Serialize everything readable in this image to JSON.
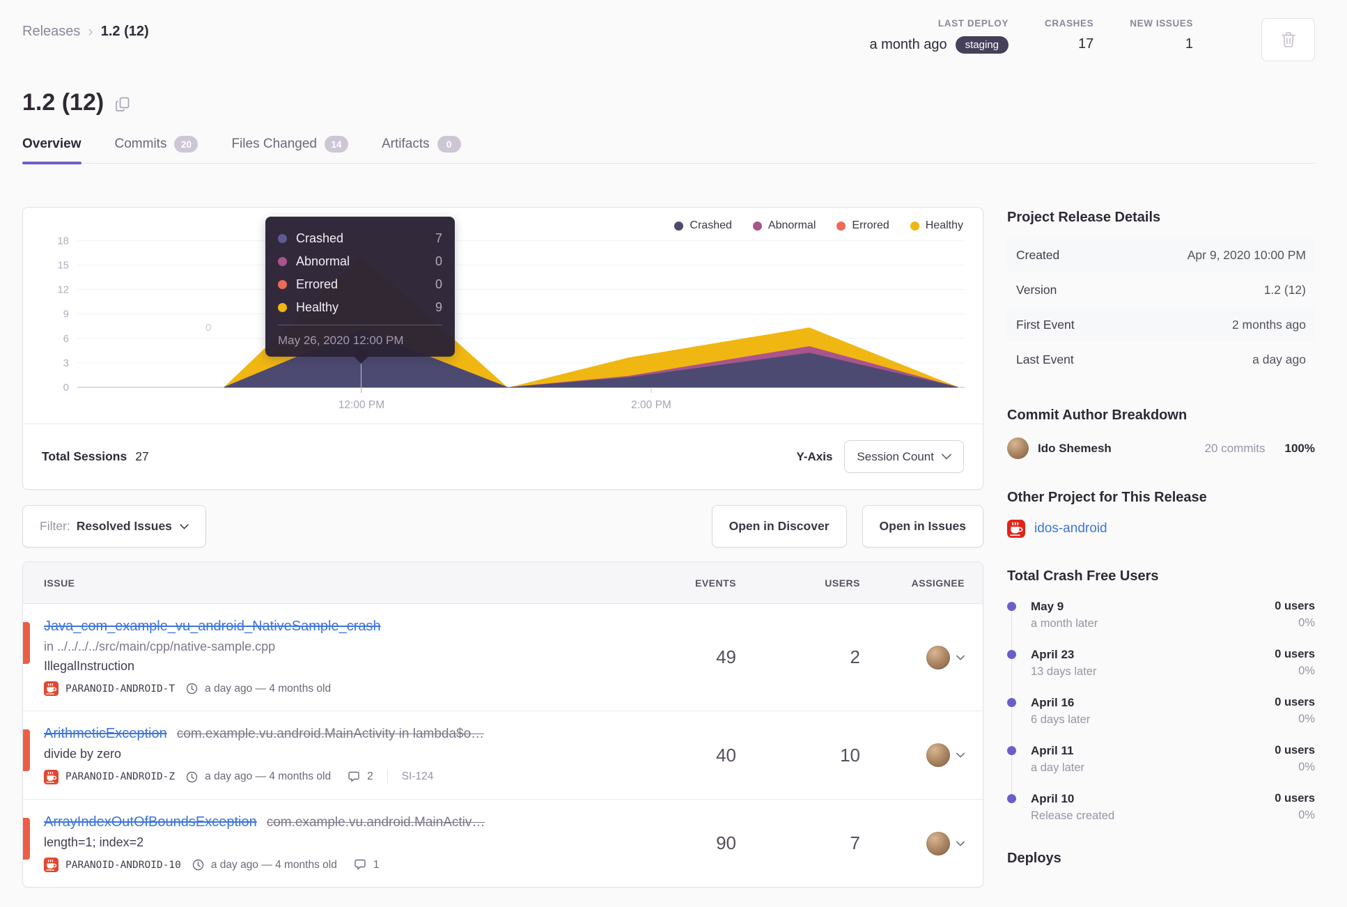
{
  "breadcrumb": {
    "parent": "Releases",
    "current": "1.2 (12)"
  },
  "header_stats": {
    "last_deploy": {
      "label": "LAST DEPLOY",
      "value": "a month ago",
      "env": "staging"
    },
    "crashes": {
      "label": "CRASHES",
      "value": "17"
    },
    "new_issues": {
      "label": "NEW ISSUES",
      "value": "1"
    }
  },
  "title": "1.2 (12)",
  "tabs": [
    {
      "label": "Overview",
      "active": true
    },
    {
      "label": "Commits",
      "badge": "20"
    },
    {
      "label": "Files Changed",
      "badge": "14"
    },
    {
      "label": "Artifacts",
      "badge": "0"
    }
  ],
  "colors": {
    "accent": "#6C5FC7",
    "link": "#3D74DB",
    "error_level": "#EC5E44",
    "env_badge": "#46405a"
  },
  "chart_data": {
    "type": "area",
    "stacked": true,
    "title": "Release sessions over time",
    "ylabel": "Session Count",
    "ylim": [
      0,
      18
    ],
    "y_ticks": [
      0,
      3,
      6,
      9,
      12,
      15,
      18
    ],
    "x_ticks": [
      {
        "label": "12:00 PM",
        "x": 460
      },
      {
        "label": "2:00 PM",
        "x": 876
      }
    ],
    "grid": true,
    "legend_position": "top-right",
    "series": [
      {
        "name": "Crashed",
        "color": "#4D4A72",
        "cum_points": [
          [
            263,
            0
          ],
          [
            460,
            7
          ],
          [
            669,
            0
          ],
          [
            674,
            0
          ],
          [
            843,
            1.2
          ],
          [
            1103,
            4.2
          ],
          [
            1316,
            0
          ]
        ]
      },
      {
        "name": "Abnormal",
        "color": "#A9548C",
        "cum_points": [
          [
            263,
            0
          ],
          [
            460,
            7
          ],
          [
            669,
            0
          ],
          [
            674,
            0
          ],
          [
            843,
            1.35
          ],
          [
            1103,
            5.0
          ],
          [
            1316,
            0
          ]
        ]
      },
      {
        "name": "Errored",
        "color": "#ED6A56",
        "cum_points": [
          [
            263,
            0
          ],
          [
            460,
            7
          ],
          [
            669,
            0
          ],
          [
            674,
            0
          ],
          [
            843,
            1.35
          ],
          [
            1103,
            5.0
          ],
          [
            1316,
            0
          ]
        ]
      },
      {
        "name": "Healthy",
        "color": "#F0B712",
        "cum_points": [
          [
            263,
            0
          ],
          [
            460,
            16
          ],
          [
            669,
            0
          ],
          [
            674,
            0
          ],
          [
            843,
            3.6
          ],
          [
            1103,
            7.3
          ],
          [
            1316,
            0
          ]
        ]
      }
    ],
    "hover": {
      "date": "May 26, 2020 12:00 PM",
      "rows": [
        {
          "label": "Crashed",
          "value": "7",
          "color": "#5E5B94"
        },
        {
          "label": "Abnormal",
          "value": "0",
          "color": "#A9548C"
        },
        {
          "label": "Errored",
          "value": "0",
          "color": "#ED6A56"
        },
        {
          "label": "Healthy",
          "value": "9",
          "color": "#F0B712"
        }
      ]
    },
    "stray_point_label": "0"
  },
  "chart_footer": {
    "total_label": "Total Sessions",
    "total_value": "27",
    "yaxis_label": "Y-Axis",
    "yaxis_value": "Session Count"
  },
  "filter_bar": {
    "filter_label": "Filter:",
    "filter_value": "Resolved Issues",
    "discover_button": "Open in Discover",
    "issues_button": "Open in Issues"
  },
  "issues_table": {
    "columns": {
      "issue": "ISSUE",
      "events": "EVENTS",
      "users": "USERS",
      "assignee": "ASSIGNEE"
    },
    "rows": [
      {
        "title": "Java_com_example_vu_android_NativeSample_crash",
        "location": "in ../../../../src/main/cpp/native-sample.cpp",
        "subtitle": "IllegalInstruction",
        "project": "PARANOID-ANDROID-T",
        "age": "a day ago — 4 months old",
        "events": "49",
        "users": "2"
      },
      {
        "title": "ArithmeticException",
        "culprit": "com.example.vu.android.MainActivity in lambda$o…",
        "subtitle": "divide by zero",
        "project": "PARANOID-ANDROID-Z",
        "age": "a day ago — 4 months old",
        "comments": "2",
        "ref": "SI-124",
        "events": "40",
        "users": "10"
      },
      {
        "title": "ArrayIndexOutOfBoundsException",
        "culprit": "com.example.vu.android.MainActiv…",
        "subtitle": "length=1; index=2",
        "project": "PARANOID-ANDROID-10",
        "age": "a day ago — 4 months old",
        "comments": "1",
        "events": "90",
        "users": "7"
      }
    ]
  },
  "sidebar": {
    "release_details": {
      "heading": "Project Release Details",
      "rows": [
        {
          "key": "Created",
          "value": "Apr 9, 2020 10:00 PM"
        },
        {
          "key": "Version",
          "value": "1.2 (12)"
        },
        {
          "key": "First Event",
          "value": "2 months ago"
        },
        {
          "key": "Last Event",
          "value": "a day ago"
        }
      ]
    },
    "commit_authors": {
      "heading": "Commit Author Breakdown",
      "authors": [
        {
          "name": "Ido Shemesh",
          "commits": "20 commits",
          "percent": "100%"
        }
      ]
    },
    "other_project": {
      "heading": "Other Project for This Release",
      "project": "idos-android"
    },
    "crash_free": {
      "heading": "Total Crash Free Users",
      "items": [
        {
          "date": "May 9",
          "sub": "a month later",
          "users": "0 users",
          "percent": "0%"
        },
        {
          "date": "April 23",
          "sub": "13 days later",
          "users": "0 users",
          "percent": "0%"
        },
        {
          "date": "April 16",
          "sub": "6 days later",
          "users": "0 users",
          "percent": "0%"
        },
        {
          "date": "April 11",
          "sub": "a day later",
          "users": "0 users",
          "percent": "0%"
        },
        {
          "date": "April 10",
          "sub": "Release created",
          "users": "0 users",
          "percent": "0%"
        }
      ]
    },
    "deploys_heading": "Deploys"
  }
}
